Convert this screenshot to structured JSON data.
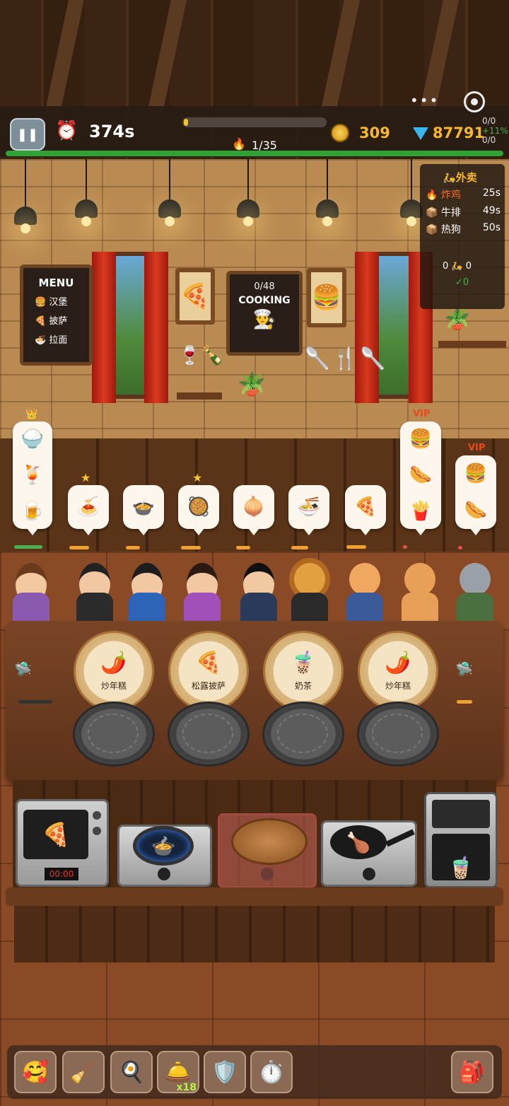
{
  "hud": {
    "pause_icon": "pause-icon",
    "timer": "374s",
    "progress": "1/35",
    "progress_fraction": 0.03,
    "coins": "309",
    "gems": "87791",
    "small_stat_1": "0/0",
    "small_stat_2": "+11%",
    "small_stat_3": "0/0",
    "more_label": "•••",
    "target_icon": "target-icon"
  },
  "delivery": {
    "title": "外卖",
    "items": [
      {
        "name": "炸鸡",
        "time": "25s",
        "color": "#f0722a"
      },
      {
        "name": "牛排",
        "time": "49s",
        "color": "#ffffff"
      },
      {
        "name": "热狗",
        "time": "50s",
        "color": "#ffffff"
      }
    ],
    "stats": "0 🛵 0",
    "done": "✓0"
  },
  "menu_board": {
    "title": "MENU",
    "items": [
      {
        "icon": "🍔",
        "label": "汉堡"
      },
      {
        "icon": "🍕",
        "label": "披萨"
      },
      {
        "icon": "🍜",
        "label": "拉面"
      }
    ]
  },
  "cooking_board": {
    "count": "0/48",
    "title": "COOKING"
  },
  "orders": [
    {
      "items": [
        "🍚",
        "🍹",
        "🍺"
      ],
      "badge": "crown",
      "vip": "",
      "bar_color": "#4caf50"
    },
    {
      "items": [
        "🍝"
      ],
      "badge": "star",
      "vip": "",
      "bar_color": "#f0a030"
    },
    {
      "items": [
        "🍲"
      ],
      "badge": "",
      "vip": "",
      "bar_color": "#f0a030"
    },
    {
      "items": [
        "🥘"
      ],
      "badge": "star",
      "vip": "",
      "bar_color": "#f0a030"
    },
    {
      "items": [
        "🧅"
      ],
      "badge": "",
      "vip": "",
      "bar_color": "#f0a030"
    },
    {
      "items": [
        "🍜"
      ],
      "badge": "",
      "vip": "",
      "bar_color": "#f0a030"
    },
    {
      "items": [
        "🍕"
      ],
      "badge": "",
      "vip": "",
      "bar_color": "#f0a030"
    },
    {
      "items": [
        "🍔",
        "🌭",
        "🍟"
      ],
      "badge": "",
      "vip": "VIP",
      "bar_color": "#e05050"
    },
    {
      "items": [
        "🍔",
        "🌭"
      ],
      "badge": "",
      "vip": "VIP",
      "bar_color": "#e05050"
    }
  ],
  "plates": [
    {
      "food": "🌶️",
      "label": "炒年糕"
    },
    {
      "food": "🍕",
      "label": "松露披萨"
    },
    {
      "food": "🧋",
      "label": "奶茶"
    },
    {
      "food": "🌶️",
      "label": "炒年糕"
    }
  ],
  "stations": [
    {
      "name": "oven",
      "display": "00:00",
      "food": "🍕"
    },
    {
      "name": "gas-stove",
      "food": "🍲"
    },
    {
      "name": "steamer",
      "food": ""
    },
    {
      "name": "fryer",
      "food": "🍗"
    },
    {
      "name": "tea-machine",
      "food": "🧋"
    }
  ],
  "tools": [
    {
      "icon": "🥰",
      "badge": ""
    },
    {
      "icon": "🧹",
      "badge": ""
    },
    {
      "icon": "🍳",
      "badge": ""
    },
    {
      "icon": "🛎️",
      "badge": "x18"
    },
    {
      "icon": "🛡️",
      "badge": ""
    },
    {
      "icon": "⏱️",
      "badge": ""
    },
    {
      "icon": "🎒",
      "badge": ""
    }
  ]
}
